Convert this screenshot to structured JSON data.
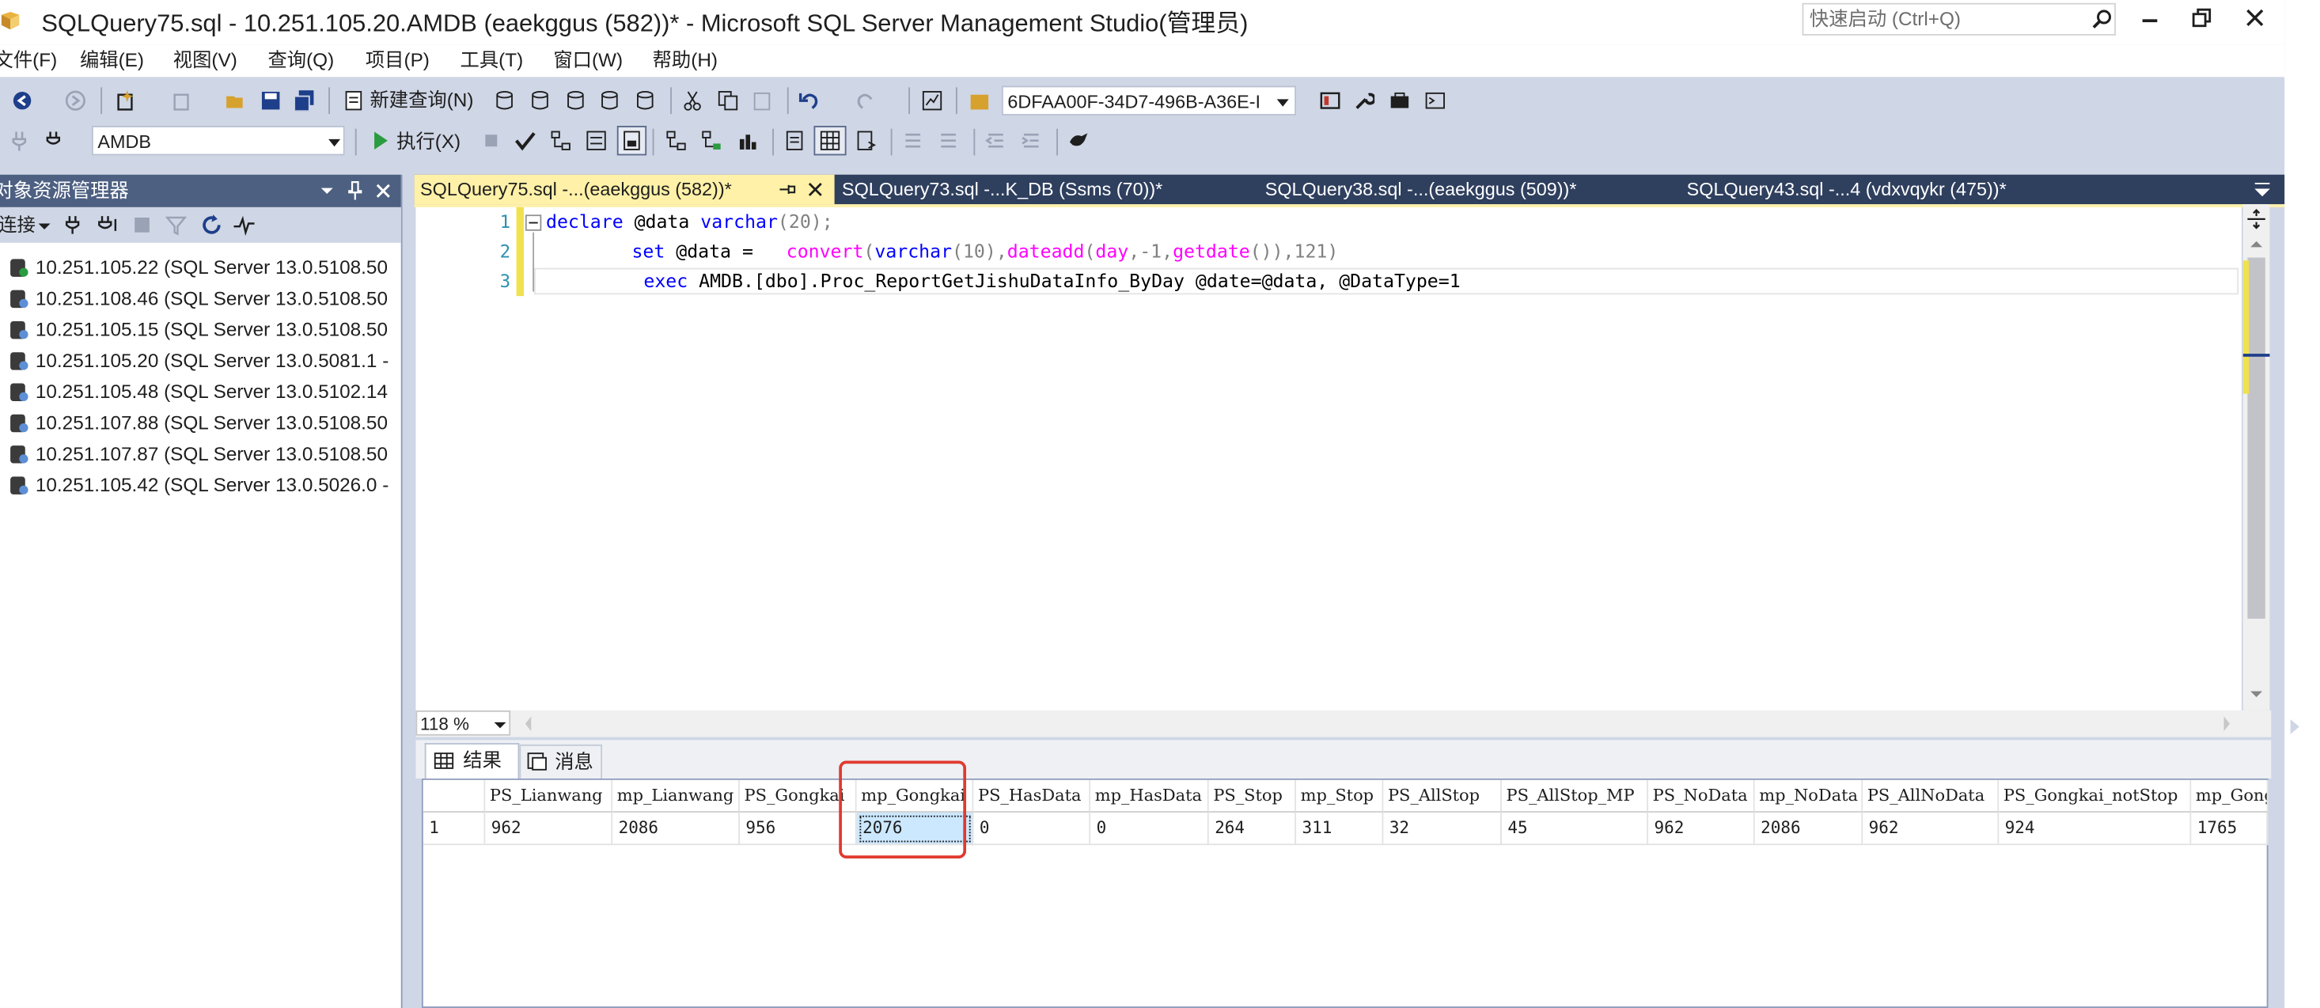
{
  "window": {
    "title": "SQLQuery75.sql - 10.251.105.20.AMDB (eaekggus (582))* - Microsoft SQL Server Management Studio(管理员)",
    "quick_launch_placeholder": "快速启动 (Ctrl+Q)"
  },
  "menu": [
    "文件(F)",
    "编辑(E)",
    "视图(V)",
    "查询(Q)",
    "项目(P)",
    "工具(T)",
    "窗口(W)",
    "帮助(H)"
  ],
  "toolbar": {
    "new_query_label": "新建查询(N)",
    "solution_guid": "6DFAA00F-34D7-496B-A36E-I",
    "database": "AMDB",
    "execute_label": "执行(X)"
  },
  "object_explorer": {
    "title": "对象资源管理器",
    "connect_label": "连接",
    "servers": [
      "10.251.105.22 (SQL Server 13.0.5108.50",
      "10.251.108.46 (SQL Server 13.0.5108.50",
      "10.251.105.15 (SQL Server 13.0.5108.50",
      "10.251.105.20 (SQL Server 13.0.5081.1 -",
      "10.251.105.48 (SQL Server 13.0.5102.14",
      "10.251.107.88 (SQL Server 13.0.5108.50",
      "10.251.107.87 (SQL Server 13.0.5108.50",
      "10.251.105.42 (SQL Server 13.0.5026.0 -"
    ]
  },
  "tabs": [
    "SQLQuery75.sql -...(eaekggus (582))*",
    "SQLQuery73.sql -...K_DB (Ssms (70))*",
    "SQLQuery38.sql -...(eaekggus (509))*",
    "SQLQuery43.sql -...4 (vdxvqykr (475))*"
  ],
  "editor": {
    "line_numbers": [
      "1",
      "2",
      "3"
    ],
    "line1": {
      "kw1": "declare",
      "var": " @data ",
      "kw2": "varchar",
      "rest": "(20);"
    },
    "line2": {
      "kw1": "set",
      "var": " @data =   ",
      "f1": "convert",
      "p1": "(",
      "kw2": "varchar",
      "p2": "(10),",
      "f2": "dateadd",
      "p3": "(",
      "kw3": "day",
      "p4": ",-1,",
      "f3": "getdate",
      "p5": "()),121)"
    },
    "line3": {
      "kw1": "exec",
      "rest": " AMDB.[dbo].Proc_ReportGetJishuDataInfo_ByDay @date=@data, @DataType=1"
    }
  },
  "zoom": "118 %",
  "results": {
    "tab_results": "结果",
    "tab_messages": "消息",
    "columns": [
      "PS_Lianwang",
      "mp_Lianwang",
      "PS_Gongkai",
      "mp_Gongkai",
      "PS_HasData",
      "mp_HasData",
      "PS_Stop",
      "mp_Stop",
      "PS_AllStop",
      "PS_AllStop_MP",
      "PS_NoData",
      "mp_NoData",
      "PS_AllNoData",
      "PS_Gongkai_notStop",
      "mp_Gong"
    ],
    "row_number": "1",
    "row": [
      "962",
      "2086",
      "956",
      "2076",
      "0",
      "0",
      "264",
      "311",
      "32",
      "45",
      "962",
      "2086",
      "962",
      "924",
      "1765"
    ]
  },
  "colors": {
    "accent_highlight": "#e03a2f",
    "active_tab": "#fff1a8"
  }
}
